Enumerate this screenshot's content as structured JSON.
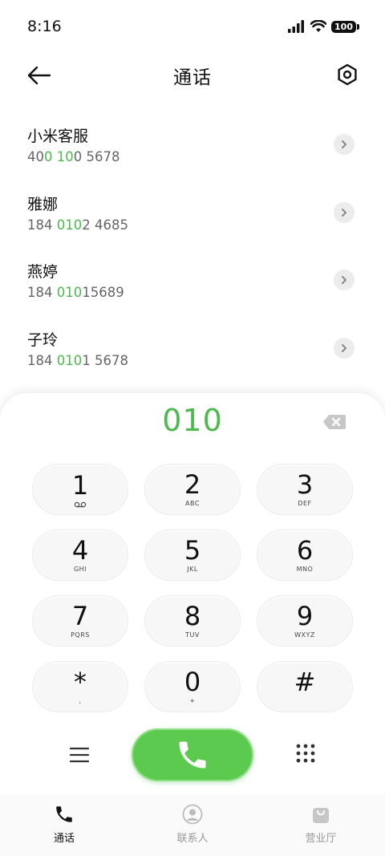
{
  "status_bar": {
    "time": "8:16",
    "battery": "100"
  },
  "header": {
    "title": "通话"
  },
  "contacts": [
    {
      "name": "小米客服",
      "number_parts": [
        "40",
        "0",
        " ",
        "10",
        "0 5678"
      ]
    },
    {
      "name": "雅娜",
      "number_parts": [
        "184 ",
        "010",
        "2 4685",
        "",
        ""
      ]
    },
    {
      "name": "燕婷",
      "number_parts": [
        "184 ",
        "010",
        "15689",
        "",
        ""
      ]
    },
    {
      "name": "子玲",
      "number_parts": [
        "184 ",
        "010",
        "1 5678",
        "",
        ""
      ]
    }
  ],
  "dialer": {
    "input": "010",
    "keys": [
      {
        "digit": "1",
        "letters": ""
      },
      {
        "digit": "2",
        "letters": "ABC"
      },
      {
        "digit": "3",
        "letters": "DEF"
      },
      {
        "digit": "4",
        "letters": "GHI"
      },
      {
        "digit": "5",
        "letters": "JKL"
      },
      {
        "digit": "6",
        "letters": "MNO"
      },
      {
        "digit": "7",
        "letters": "PQRS"
      },
      {
        "digit": "8",
        "letters": "TUV"
      },
      {
        "digit": "9",
        "letters": "WXYZ"
      },
      {
        "digit": "*",
        "letters": ","
      },
      {
        "digit": "0",
        "letters": "+"
      },
      {
        "digit": "#",
        "letters": ""
      }
    ]
  },
  "bottom_nav": [
    {
      "label": "通话",
      "icon": "phone-icon",
      "active": true
    },
    {
      "label": "联系人",
      "icon": "person-icon",
      "active": false
    },
    {
      "label": "营业厅",
      "icon": "bag-icon",
      "active": false
    }
  ],
  "colors": {
    "accent": "#4cba4c",
    "call_button": "#5cc94f"
  }
}
